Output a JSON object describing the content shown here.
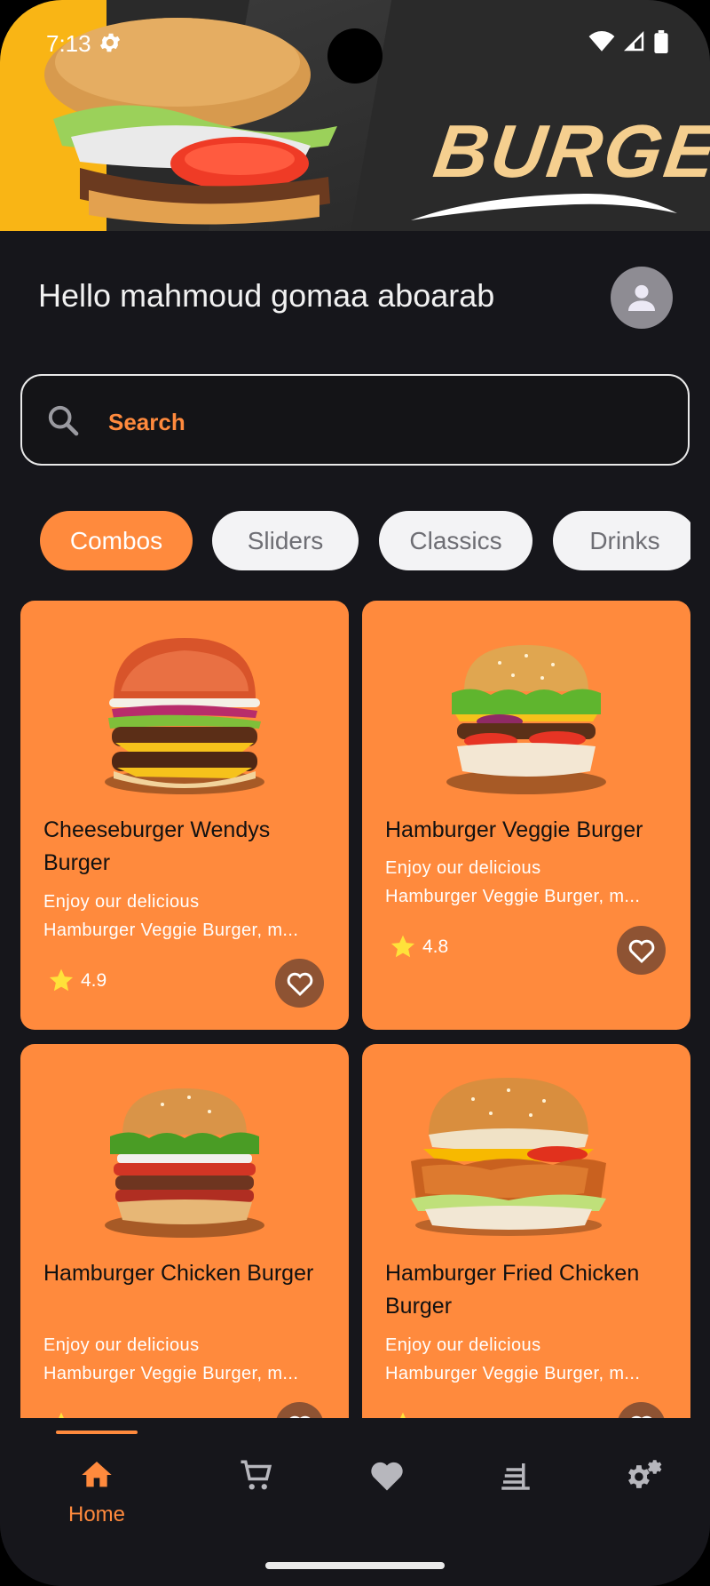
{
  "status_bar": {
    "time": "7:13"
  },
  "banner": {
    "brand_text": "BURGER"
  },
  "greeting": "Hello mahmoud gomaa aboarab",
  "search": {
    "placeholder": "Search"
  },
  "categories": [
    {
      "label": "Combos",
      "active": true
    },
    {
      "label": "Sliders",
      "active": false
    },
    {
      "label": "Classics",
      "active": false
    },
    {
      "label": "Drinks",
      "active": false
    }
  ],
  "products": [
    {
      "title": "Cheeseburger Wendys Burger",
      "desc_line1": "Enjoy our delicious",
      "desc_line2": "Hamburger Veggie Burger, m...",
      "rating": "4.9",
      "image_icon": "double-cheeseburger-image"
    },
    {
      "title": "Hamburger Veggie Burger",
      "desc_line1": "Enjoy our delicious",
      "desc_line2": "Hamburger Veggie Burger, m...",
      "rating": "4.8",
      "image_icon": "veggie-burger-image"
    },
    {
      "title": "Hamburger Chicken Burger",
      "desc_line1": "Enjoy our delicious",
      "desc_line2": "Hamburger Veggie Burger, m...",
      "rating": "",
      "image_icon": "chicken-burger-image"
    },
    {
      "title": "Hamburger Fried Chicken Burger",
      "desc_line1": "Enjoy our delicious",
      "desc_line2": "Hamburger Veggie Burger, m...",
      "rating": "",
      "image_icon": "fried-chicken-burger-image"
    }
  ],
  "nav": {
    "items": [
      {
        "label": "Home",
        "icon": "home-icon",
        "active": true
      },
      {
        "label": "",
        "icon": "cart-icon",
        "active": false
      },
      {
        "label": "",
        "icon": "heart-icon",
        "active": false
      },
      {
        "label": "",
        "icon": "orders-icon",
        "active": false
      },
      {
        "label": "",
        "icon": "settings-icon",
        "active": false
      }
    ]
  },
  "colors": {
    "accent": "#ff8a3d",
    "background": "#16161b",
    "chip_inactive": "#f3f3f5",
    "favorite_bg": "#8e5333"
  }
}
